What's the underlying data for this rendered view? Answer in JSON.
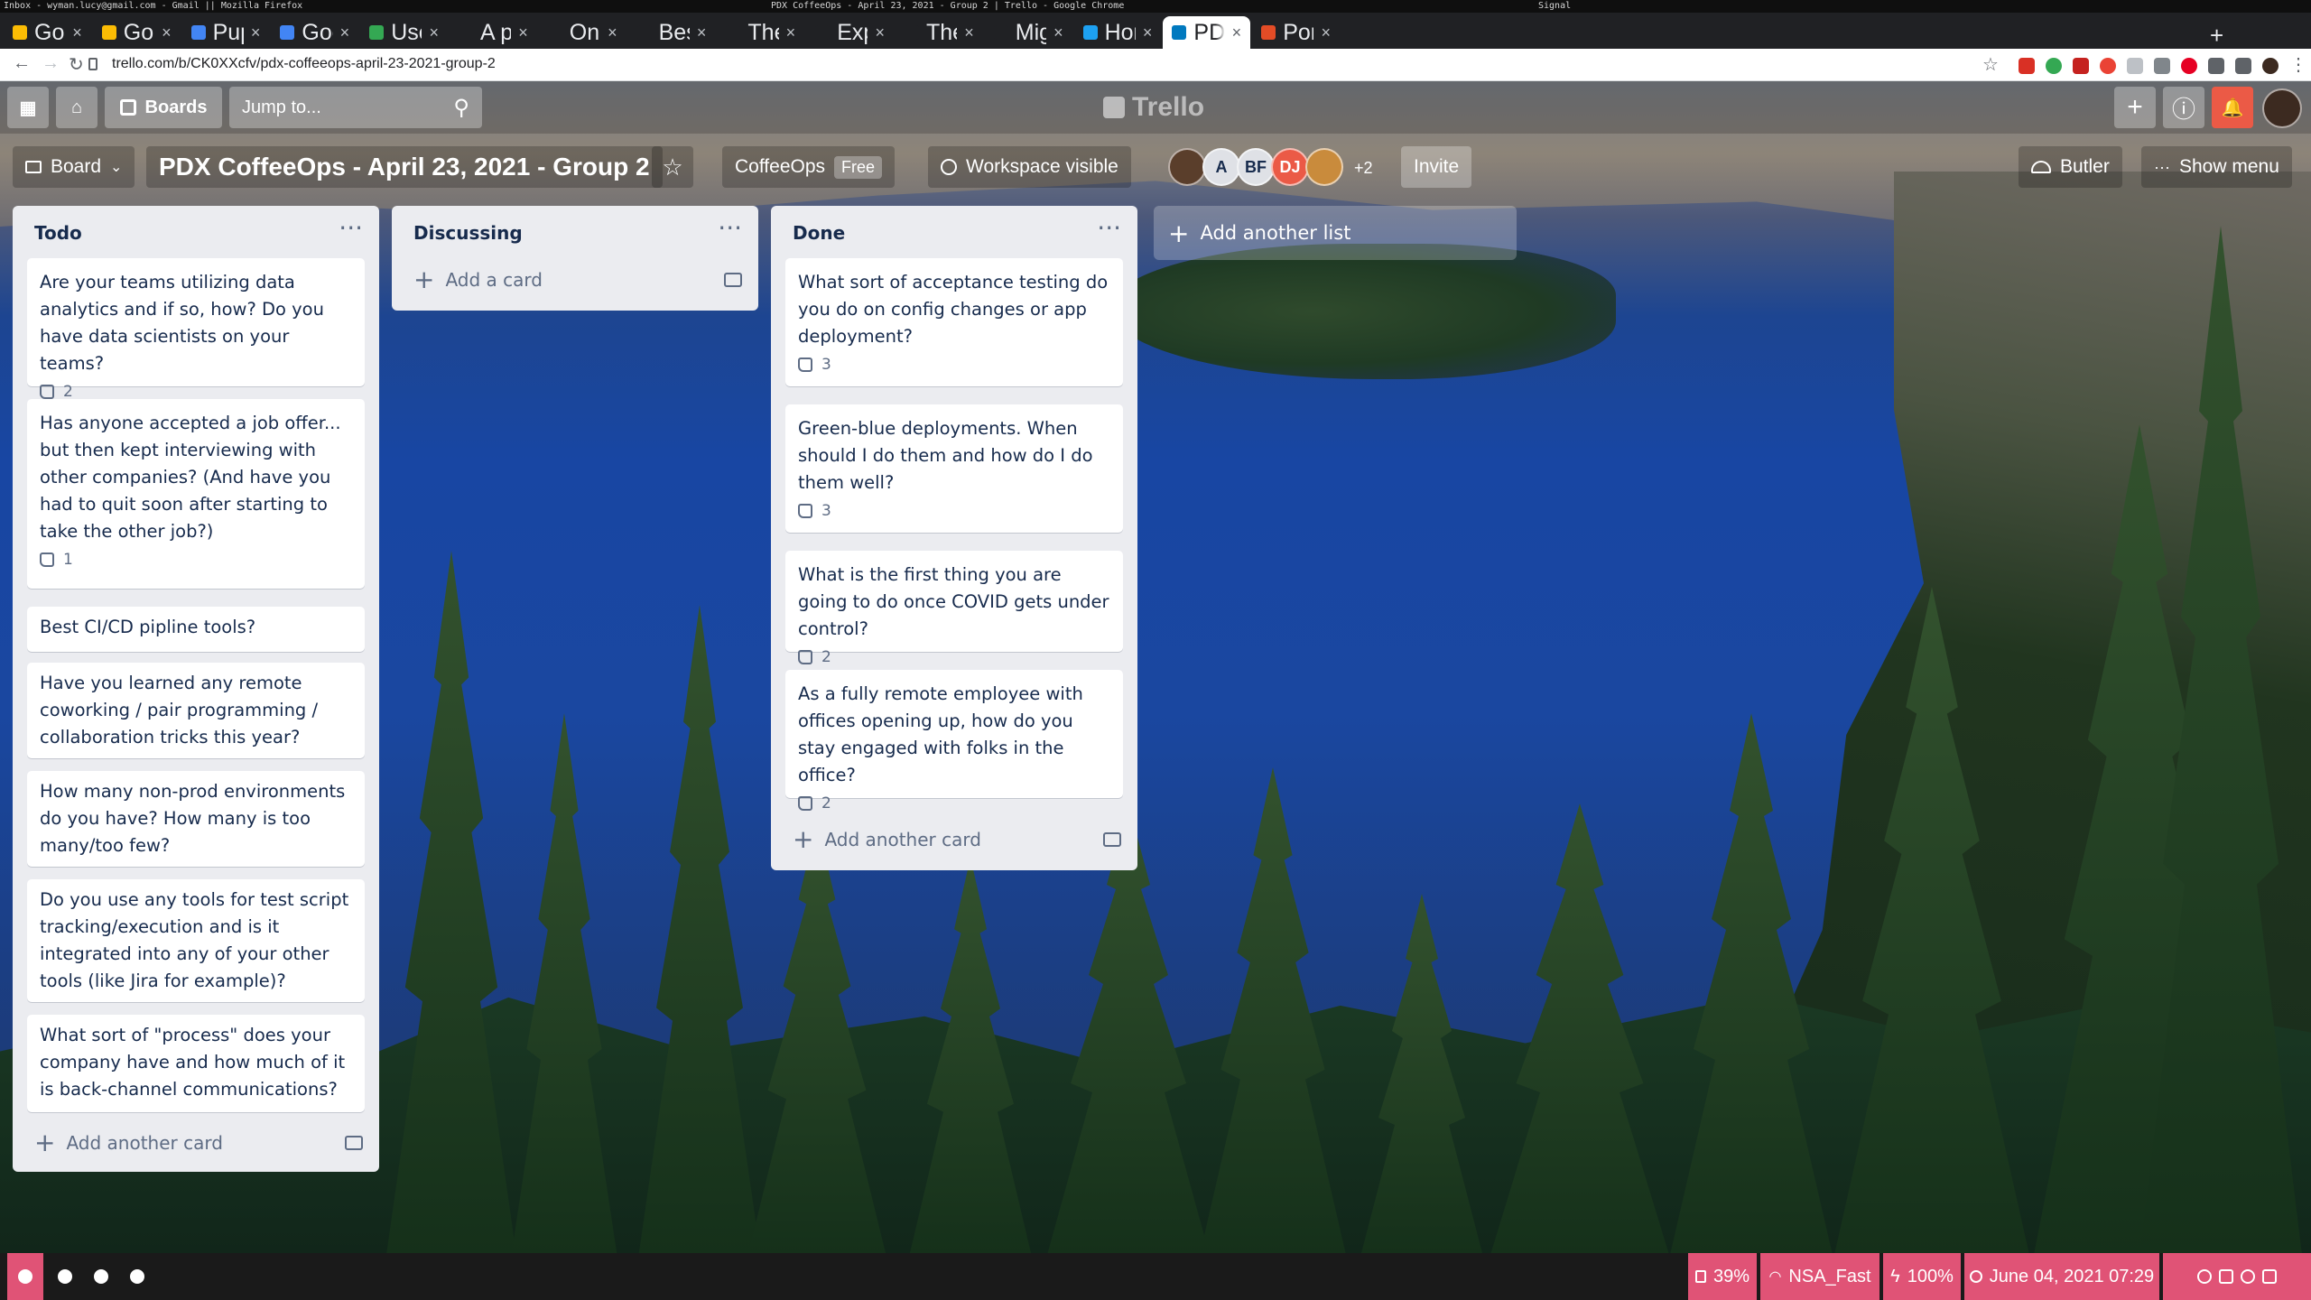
{
  "wm_bar": {
    "left": "Inbox - wyman.lucy@gmail.com - Gmail || Mozilla Firefox",
    "center": "PDX CoffeeOps - April 23, 2021 - Group 2 | Trello - Google Chrome",
    "right": "Signal"
  },
  "browser": {
    "tabs": [
      {
        "title": "Google",
        "close": "×"
      },
      {
        "title": "Google",
        "close": "×"
      },
      {
        "title": "Puppet",
        "close": "×"
      },
      {
        "title": "Google",
        "close": "×"
      },
      {
        "title": "User qu",
        "close": "×"
      },
      {
        "title": "A prime",
        "close": "×"
      },
      {
        "title": "On the",
        "close": "×"
      },
      {
        "title": "Best pra",
        "close": "×"
      },
      {
        "title": "The Clo",
        "close": "×"
      },
      {
        "title": "Explorin",
        "close": "×"
      },
      {
        "title": "The life",
        "close": "×"
      },
      {
        "title": "Migratin",
        "close": "×"
      },
      {
        "title": "Home /",
        "close": "×"
      },
      {
        "title": "PDX Cof",
        "close": "×"
      },
      {
        "title": "Portland",
        "close": "×"
      }
    ],
    "new_tab": "+",
    "back": "←",
    "forward": "→",
    "reload": "↻",
    "url": "trello.com/b/CK0XXcfv/pdx-coffeeops-april-23-2021-group-2",
    "star": "☆",
    "menu": "⋮"
  },
  "trello_header": {
    "apps_glyph": "▦",
    "home_glyph": "⌂",
    "boards_label": "Boards",
    "search_placeholder": "Jump to...",
    "search_glyph": "⚲",
    "logo_text": "Trello",
    "create_glyph": "+",
    "info_glyph": "ⓘ",
    "bell_glyph": "🔔",
    "bell_color": "#eb5a46"
  },
  "board_header": {
    "view_label": "Board",
    "title": "PDX CoffeeOps - April 23, 2021 - Group 2",
    "star_glyph": "☆",
    "workspace_name": "CoffeeOps",
    "workspace_plan": "Free",
    "visibility_label": "Workspace visible",
    "members": [
      {
        "initials": "",
        "color": "#5a3e2b"
      },
      {
        "initials": "A",
        "color": "#dfe1e6"
      },
      {
        "initials": "BF",
        "color": "#dfe1e6"
      },
      {
        "initials": "DJ",
        "color": "#eb5a46"
      },
      {
        "initials": "",
        "color": "#c98b3c"
      }
    ],
    "members_more": "+2",
    "invite_label": "Invite",
    "butler_label": "Butler",
    "show_menu_label": "Show menu"
  },
  "lists": [
    {
      "title": "Todo",
      "menu": "···",
      "add_label": "Add another card",
      "cards": [
        {
          "text": "Are your teams utilizing data analytics and if so, how? Do you have data scientists on your teams?",
          "likes": "2"
        },
        {
          "text": "Has anyone accepted a job offer... but then kept interviewing with other companies? (And have you had to quit soon after starting to take the other job?)",
          "likes": "1"
        },
        {
          "text": "Best CI/CD pipline tools?",
          "likes": ""
        },
        {
          "text": "Have you learned any remote coworking / pair programming / collaboration tricks this year?",
          "likes": ""
        },
        {
          "text": "How many non-prod environments do you have? How many is too many/too few?",
          "likes": ""
        },
        {
          "text": "Do you use any tools for test script tracking/execution and is it integrated into any of your other tools (like Jira for example)?",
          "likes": ""
        },
        {
          "text": "What sort of \"process\" does your company have and how much of it is back-channel communications?",
          "likes": ""
        }
      ]
    },
    {
      "title": "Discussing",
      "menu": "···",
      "add_label": "Add a card",
      "cards": []
    },
    {
      "title": "Done",
      "menu": "···",
      "add_label": "Add another card",
      "cards": [
        {
          "text": "What sort of acceptance testing do you do on config changes or app deployment?",
          "likes": "3"
        },
        {
          "text": "Green-blue deployments. When should I do them and how do I do them well?",
          "likes": "3"
        },
        {
          "text": "What is the first thing you are going to do once COVID gets under control?",
          "likes": "2"
        },
        {
          "text": "As a fully remote employee with offices opening up, how do you stay engaged with folks in the office?",
          "likes": "2"
        }
      ]
    }
  ],
  "add_list_label": "Add another list",
  "taskbar": {
    "disk": "39%",
    "wifi": "NSA_Fast",
    "battery": "100%",
    "datetime": "June 04, 2021 07:29",
    "accent": "#e05376"
  }
}
